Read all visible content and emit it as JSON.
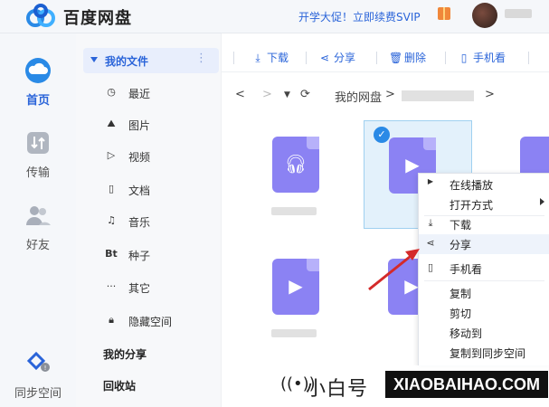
{
  "header": {
    "app_title": "百度网盘",
    "promo_text": "开学大促！立即续费SVIP"
  },
  "rail": {
    "items": [
      {
        "label": "首页",
        "active": true
      },
      {
        "label": "传输",
        "active": false
      },
      {
        "label": "好友",
        "active": false
      },
      {
        "label": "同步空间",
        "active": false
      }
    ]
  },
  "tree": {
    "head": "我的文件",
    "items": [
      {
        "icon": "clock-icon",
        "label": "最近"
      },
      {
        "icon": "picture-icon",
        "label": "图片"
      },
      {
        "icon": "play-icon",
        "label": "视频"
      },
      {
        "icon": "document-icon",
        "label": "文档"
      },
      {
        "icon": "headphones-icon",
        "label": "音乐"
      },
      {
        "icon": "bt-icon",
        "label": "种子",
        "glyph": "Bt"
      },
      {
        "icon": "more-icon",
        "label": "其它"
      },
      {
        "icon": "lock-icon",
        "label": "隐藏空间"
      }
    ],
    "sections": [
      "我的分享",
      "回收站"
    ]
  },
  "toolbar": {
    "download": "下载",
    "share": "分享",
    "delete": "删除",
    "phone": "手机看"
  },
  "breadcrumb": {
    "root": "我的网盘",
    "separator": ">"
  },
  "context_menu": {
    "items": [
      {
        "label": "在线播放",
        "icon": "play-icon"
      },
      {
        "label": "打开方式",
        "submenu": true
      },
      {
        "label": "下载",
        "icon": "download-icon"
      },
      {
        "label": "分享",
        "icon": "share-icon"
      },
      {
        "label": "手机看",
        "icon": "phone-icon"
      },
      {
        "label": "复制"
      },
      {
        "label": "剪切"
      },
      {
        "label": "移动到"
      },
      {
        "label": "复制到同步空间"
      }
    ]
  },
  "watermark": {
    "cn": "小白号",
    "en": "XIAOBAIHAO.COM"
  },
  "colors": {
    "accent": "#2a64d9",
    "file_icon": "#8b82f3",
    "arrow": "#d42a2a",
    "selected_bg": "#e3f1fb"
  }
}
